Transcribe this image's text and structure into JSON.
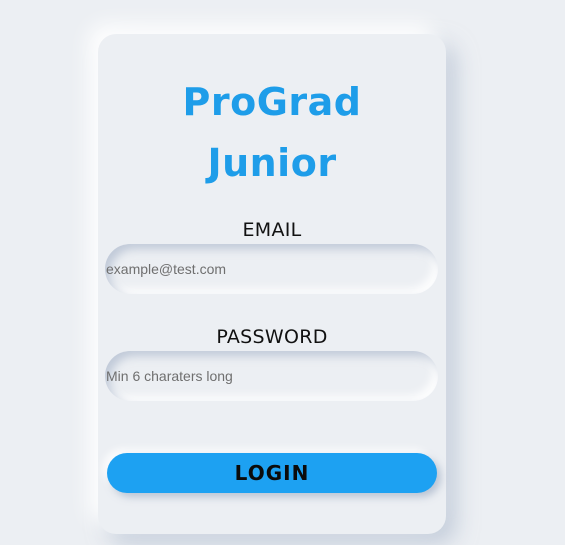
{
  "login_card": {
    "title_line1": "ProGrad",
    "title_line2": "Junior",
    "email_label": "EMAIL",
    "email_placeholder": "example@test.com",
    "email_value": "",
    "password_label": "PASSWORD",
    "password_placeholder": "Min 6 charaters long",
    "password_value": "",
    "login_button_label": "LOGIN"
  },
  "colors": {
    "background": "#eceff3",
    "accent": "#1da1f2",
    "title": "#1e9de9"
  }
}
